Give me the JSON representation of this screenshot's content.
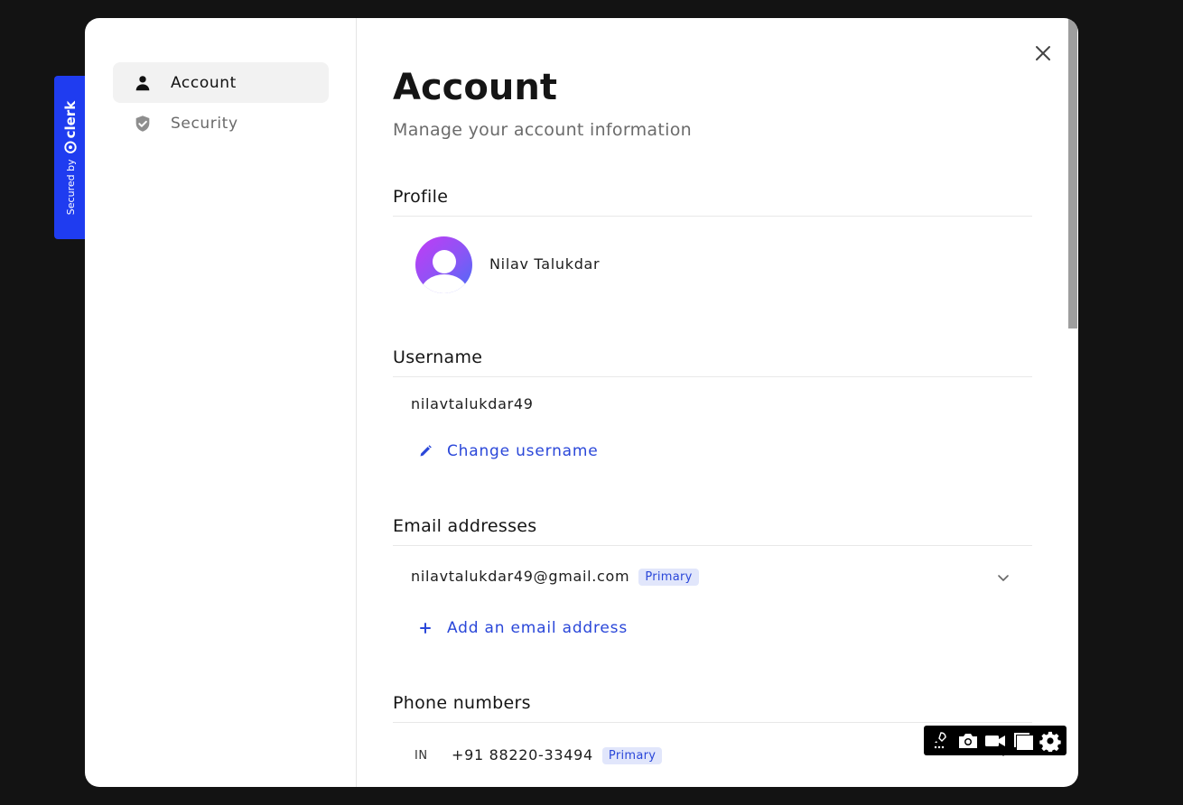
{
  "badge": {
    "secured_label": "Secured by",
    "brand": "clerk",
    "brand_color": "#1f3cf0"
  },
  "sidebar": {
    "items": [
      {
        "label": "Account",
        "icon": "user-icon",
        "active": true
      },
      {
        "label": "Security",
        "icon": "shield-check-icon",
        "active": false
      }
    ]
  },
  "main": {
    "title": "Account",
    "subtitle": "Manage your account information",
    "profile": {
      "heading": "Profile",
      "name": "Nilav Talukdar",
      "avatar_icon": "avatar-icon"
    },
    "username": {
      "heading": "Username",
      "value": "nilavtalukdar49",
      "change_label": "Change username"
    },
    "email": {
      "heading": "Email addresses",
      "address": "nilavtalukdar49@gmail.com",
      "primary_badge": "Primary",
      "add_label": "Add an email address"
    },
    "phone": {
      "heading": "Phone numbers",
      "country_code": "IN",
      "number": "+91 88220-33494",
      "primary_badge": "Primary"
    }
  },
  "colors": {
    "accent": "#2a47d9",
    "badge_bg": "#e1e6fb",
    "background": "#131313"
  },
  "toolbar": {
    "icons": [
      "rocket-icon",
      "camera-icon",
      "video-icon",
      "window-icon",
      "gear-icon"
    ]
  }
}
